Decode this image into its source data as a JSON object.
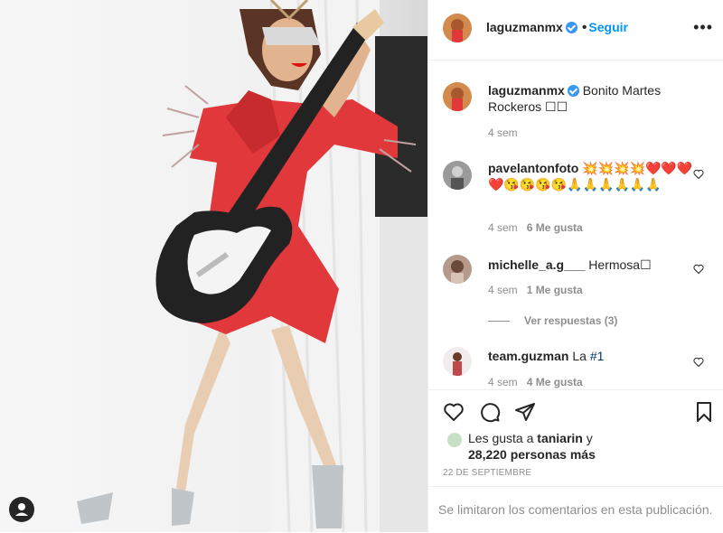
{
  "post": {
    "username": "laguzmanmx",
    "follow_label": "Seguir",
    "more_label": "•••",
    "caption": "Bonito Martes Rockeros ☐☐",
    "caption_time": "4 sem"
  },
  "comments": [
    {
      "user": "pavelantonfoto",
      "text": "💥💥💥💥❤️❤️❤️❤️😘😘😘😘🙏🙏🙏🙏🙏🙏",
      "time": "4 sem",
      "likes": "6 Me gusta"
    },
    {
      "user": "michelle_a.g___",
      "text": "Hermosa☐",
      "time": "4 sem",
      "likes": "1 Me gusta",
      "replies": "Ver respuestas (3)"
    },
    {
      "user": "team.guzman",
      "text": "La",
      "tag": "#1",
      "time": "4 sem",
      "likes": "4 Me gusta"
    }
  ],
  "likes": {
    "prefix": "Les gusta a",
    "user": "taniarin",
    "joiner": "y",
    "count": "28,220 personas más"
  },
  "date": "22 DE SEPTIEMBRE",
  "comments_disabled": "Se limitaron los comentarios en esta publicación.",
  "colors": {
    "accent": "#0095f6",
    "dress": "#e0383b",
    "text": "#262626",
    "muted": "#8e8e8e"
  },
  "icons": [
    "heart-icon",
    "comment-icon",
    "share-icon",
    "bookmark-icon",
    "verified-icon",
    "user-icon"
  ]
}
